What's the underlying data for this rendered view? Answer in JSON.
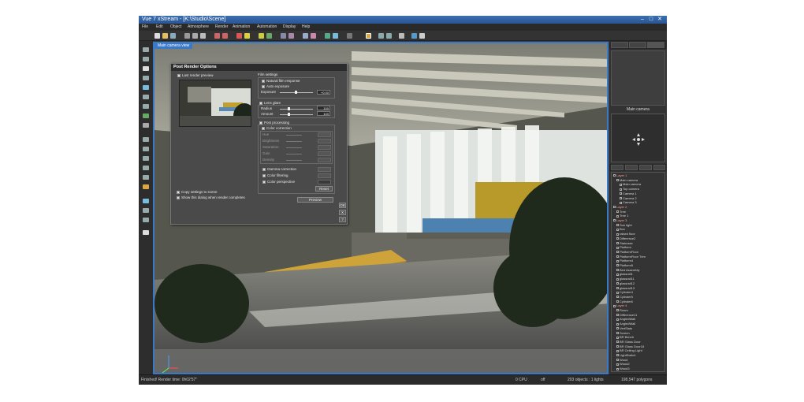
{
  "window": {
    "title": "Vue 7 xStream - [K:\\Studio\\Scene]"
  },
  "menu": [
    "File",
    "Edit",
    "Object",
    "Atmosphere",
    "Render",
    "Animation",
    "Automation",
    "Display",
    "Help"
  ],
  "viewport": {
    "label": "Main camera view"
  },
  "dialog": {
    "title": "Post Render Options",
    "last_render_preview": "Last render preview",
    "film_settings": "Film settings",
    "natural_film_response": "Natural film response",
    "auto_exposure": "Auto exposure",
    "exposure_label": "Exposure",
    "exposure_value": "+0.00",
    "lens_glare": "Lens glare",
    "radius_label": "Radius",
    "radius_value": "100",
    "amount_label": "Amount",
    "amount_value": "100",
    "post_processing": "Post processing",
    "color_correction": "Color correction",
    "hue_label": "Hue",
    "brightness_label": "Brightness",
    "saturation_label": "Saturation",
    "gain_label": "Gain",
    "density_label": "Density",
    "gamma_correction": "Gamma correction",
    "color_filtering": "Color filtering",
    "color_perspective": "Color perspective",
    "reset_button": "Reset",
    "copy_settings": "Copy settings to scene",
    "show_dialog": "Show this dialog when render completes",
    "preview_button": "Preview",
    "side_buttons": [
      "OK",
      "X",
      "?"
    ]
  },
  "right_panel": {
    "camera_label": "Main camera",
    "tree": [
      {
        "label": "Layer 1",
        "level": 0
      },
      {
        "label": "Main camera",
        "level": 1
      },
      {
        "label": "Main camera",
        "level": 2
      },
      {
        "label": "Top camera",
        "level": 2
      },
      {
        "label": "Camera 1",
        "level": 2
      },
      {
        "label": "Camera 2",
        "level": 2
      },
      {
        "label": "Camera 3",
        "level": 2
      },
      {
        "label": "Layer 2",
        "level": 0
      },
      {
        "label": "Tree",
        "level": 1
      },
      {
        "label": "Tree 1",
        "level": 1
      },
      {
        "label": "Layer 3",
        "level": 0
      },
      {
        "label": "Sun light",
        "level": 1
      },
      {
        "label": "Box",
        "level": 1
      },
      {
        "label": "raised floor",
        "level": 1
      },
      {
        "label": "Difference2",
        "level": 1
      },
      {
        "label": "Staircase",
        "level": 1
      },
      {
        "label": "Platform",
        "level": 1
      },
      {
        "label": "PlatformFloor",
        "level": 1
      },
      {
        "label": "PlatformFloor Trim",
        "level": 1
      },
      {
        "label": "Platform4",
        "level": 1
      },
      {
        "label": "Platform5",
        "level": 1
      },
      {
        "label": "Bed Assembly",
        "level": 1
      },
      {
        "label": "glassrail1",
        "level": 1
      },
      {
        "label": "glassrail11",
        "level": 1
      },
      {
        "label": "glassrail12",
        "level": 1
      },
      {
        "label": "glassrail13",
        "level": 1
      },
      {
        "label": "Cylinder4",
        "level": 1
      },
      {
        "label": "Cylinder5",
        "level": 1
      },
      {
        "label": "Cylinder6",
        "level": 1
      },
      {
        "label": "Layer 4",
        "level": 0
      },
      {
        "label": "Room",
        "level": 1
      },
      {
        "label": "Difference11",
        "level": 1
      },
      {
        "label": "AngledWall",
        "level": 1
      },
      {
        "label": "AngledWall",
        "level": 1
      },
      {
        "label": "VertSlats",
        "level": 1
      },
      {
        "label": "Screen",
        "level": 1
      },
      {
        "label": "BR Bench",
        "level": 1
      },
      {
        "label": "BR Glass Door",
        "level": 1
      },
      {
        "label": "BR Glass Door18",
        "level": 1
      },
      {
        "label": "BR Ceiling Light",
        "level": 1
      },
      {
        "label": "LightSwitch",
        "level": 1
      },
      {
        "label": "Wood",
        "level": 1
      },
      {
        "label": "Wood2",
        "level": 1
      },
      {
        "label": "Wood3",
        "level": 1
      }
    ]
  },
  "status": {
    "message": "Finished! Render time: 0h02'57\"",
    "cpu": "0 CPU",
    "mode": "off",
    "objects": "203 objects : 1 lights",
    "polygons": "198,547 polygons"
  }
}
